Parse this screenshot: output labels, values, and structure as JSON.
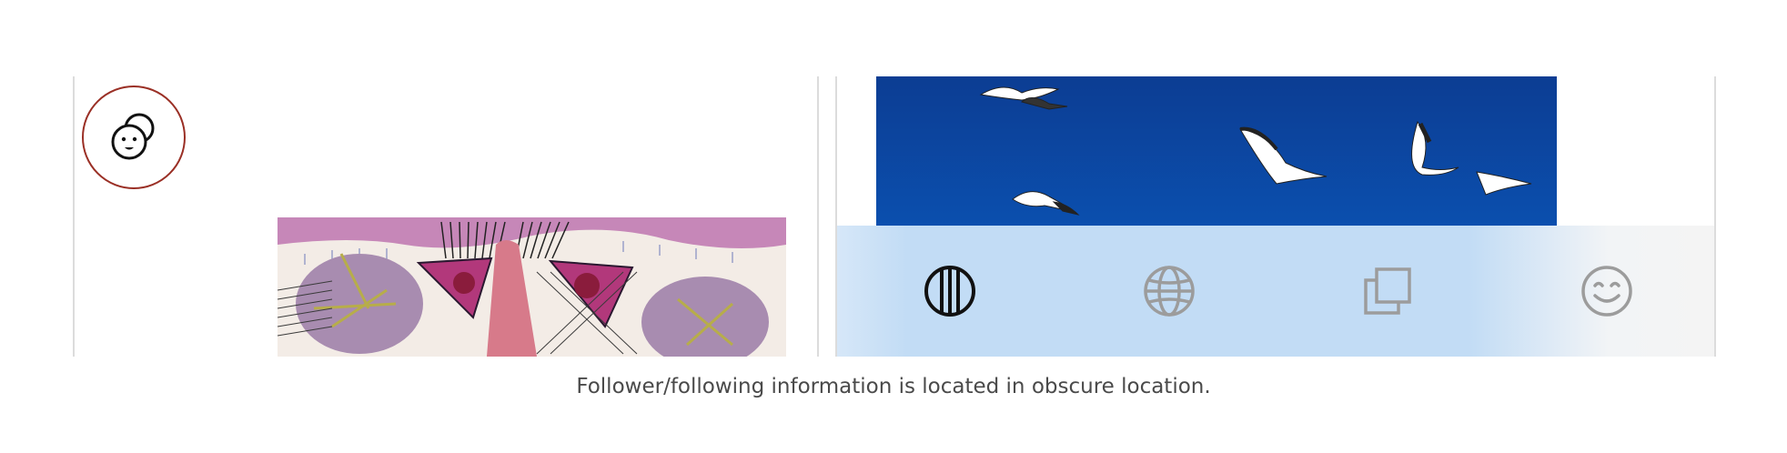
{
  "caption": "Follower/following information is located in obscure location.",
  "left_screen": {
    "profile_icon": "two-faces-icon",
    "accent_color": "#9a2f25",
    "artwork_image": "embroidered-textile-artwork"
  },
  "right_screen": {
    "photo": "seagulls-in-blue-sky",
    "tabs": [
      {
        "icon": "vertical-stripes-icon",
        "active": true
      },
      {
        "icon": "globe-icon",
        "active": false
      },
      {
        "icon": "stacked-squares-icon",
        "active": false
      },
      {
        "icon": "smiley-icon",
        "active": false
      }
    ],
    "tab_bar_color": "#c2dcf5"
  }
}
